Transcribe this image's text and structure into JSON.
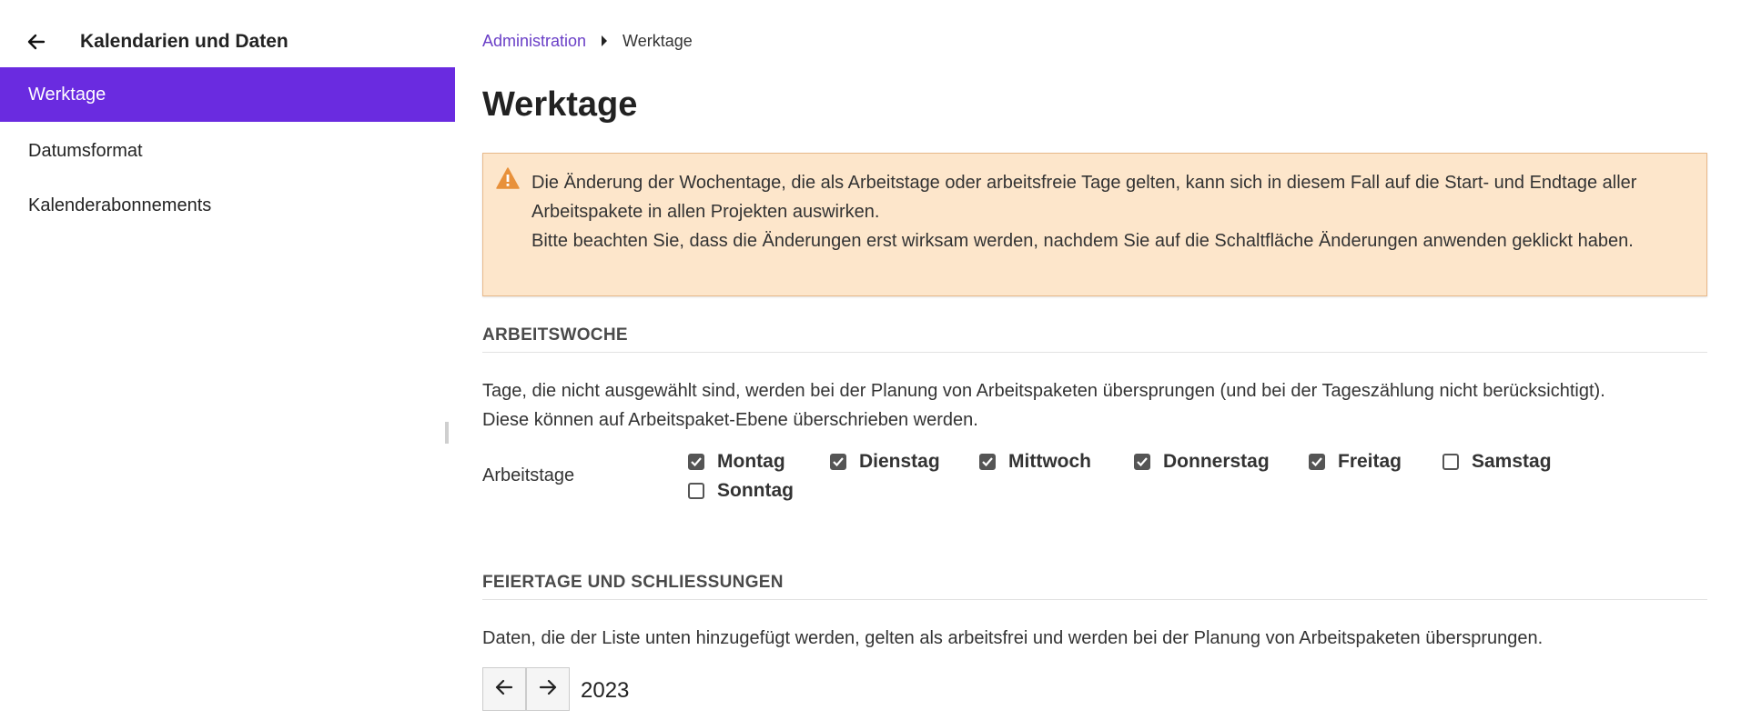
{
  "sidebar": {
    "back_icon": "arrow-left-icon",
    "title": "Kalendarien und Daten",
    "items": [
      {
        "label": "Werktage",
        "active": true
      },
      {
        "label": "Datumsformat",
        "active": false
      },
      {
        "label": "Kalenderabonnements",
        "active": false
      }
    ]
  },
  "breadcrumb": {
    "parent": "Administration",
    "separator_icon": "caret-right-icon",
    "current": "Werktage"
  },
  "page_title": "Werktage",
  "warning": {
    "icon": "warning-triangle-icon",
    "line1": "Die Änderung der Wochentage, die als Arbeitstage oder arbeitsfreie Tage gelten, kann sich in diesem Fall auf die Start- und Endtage aller Arbeitspakete in allen Projekten auswirken.",
    "line2": "Bitte beachten Sie, dass die Änderungen erst wirksam werden, nachdem Sie auf die Schaltfläche Änderungen anwenden geklickt haben."
  },
  "workweek": {
    "heading": "ARBEITSWOCHE",
    "description_line1": "Tage, die nicht ausgewählt sind, werden bei der Planung von Arbeitspaketen übersprungen (und bei der Tageszählung nicht berücksichtigt).",
    "description_line2": "Diese können auf Arbeitspaket-Ebene überschrieben werden.",
    "field_label": "Arbeitstage",
    "days": [
      {
        "label": "Montag",
        "checked": true
      },
      {
        "label": "Dienstag",
        "checked": true
      },
      {
        "label": "Mittwoch",
        "checked": true
      },
      {
        "label": "Donnerstag",
        "checked": true
      },
      {
        "label": "Freitag",
        "checked": true
      },
      {
        "label": "Samstag",
        "checked": false
      },
      {
        "label": "Sonntag",
        "checked": false
      }
    ]
  },
  "holidays": {
    "heading": "FEIERTAGE UND SCHLIESSUNGEN",
    "description": "Daten, die der Liste unten hinzugefügt werden, gelten als arbeitsfrei und werden bei der Planung von Arbeitspaketen übersprungen.",
    "prev_icon": "arrow-left-icon",
    "next_icon": "arrow-right-icon",
    "year": "2023"
  },
  "colors": {
    "accent": "#6a2be0",
    "link": "#6a3fc7",
    "warning_bg": "#fde6cb",
    "warning_icon": "#e8913b"
  }
}
